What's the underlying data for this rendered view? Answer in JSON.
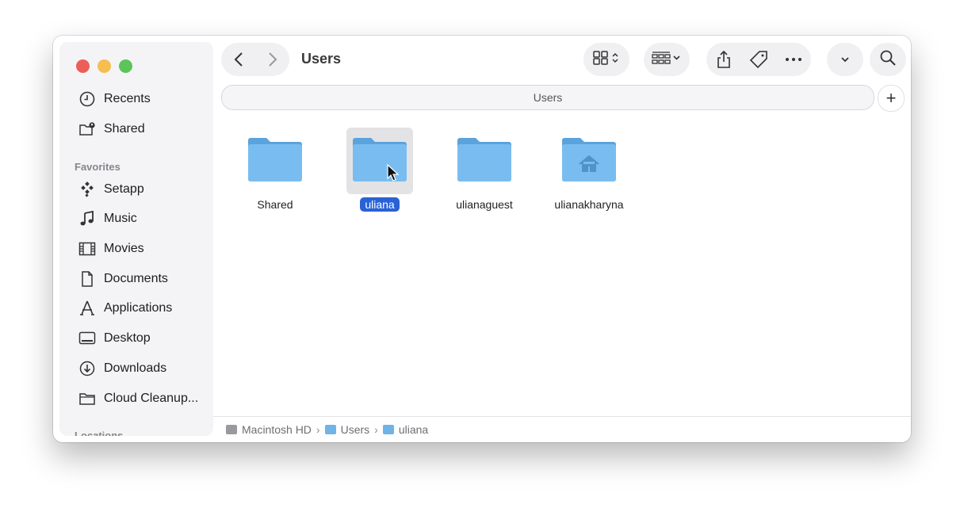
{
  "window": {
    "title": "Users",
    "path_bar_label": "Users",
    "add_tab_label": "+"
  },
  "colors": {
    "accent": "#2a62d6",
    "folder": "#6fb3e8",
    "close": "#ec5f59",
    "minimize": "#f5be4f",
    "maximize": "#5dc459"
  },
  "sidebar": {
    "items_top": [
      {
        "label": "Recents",
        "icon": "clock-icon"
      },
      {
        "label": "Shared",
        "icon": "shared-folder-icon"
      }
    ],
    "favorites_header": "Favorites",
    "favorites": [
      {
        "label": "Setapp",
        "icon": "setapp-icon"
      },
      {
        "label": "Music",
        "icon": "music-note-icon"
      },
      {
        "label": "Movies",
        "icon": "film-icon"
      },
      {
        "label": "Documents",
        "icon": "document-icon"
      },
      {
        "label": "Applications",
        "icon": "applications-icon"
      },
      {
        "label": "Desktop",
        "icon": "desktop-icon"
      },
      {
        "label": "Downloads",
        "icon": "download-icon"
      },
      {
        "label": "Cloud Cleanup...",
        "icon": "folder-icon"
      }
    ],
    "locations_header": "Locations"
  },
  "content": {
    "items": [
      {
        "name": "Shared",
        "type": "folder",
        "selected": false
      },
      {
        "name": "uliana",
        "type": "folder",
        "selected": true
      },
      {
        "name": "ulianaguest",
        "type": "folder",
        "selected": false
      },
      {
        "name": "ulianakharyna",
        "type": "home-folder",
        "selected": false
      }
    ]
  },
  "statusbar": {
    "crumbs": [
      "Macintosh HD",
      "Users",
      "uliana"
    ],
    "separator": "›"
  }
}
